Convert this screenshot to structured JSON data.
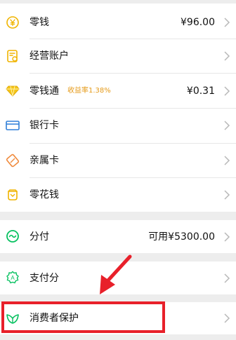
{
  "wallet_items": [
    {
      "label": "零钱",
      "value": "¥96.00",
      "icon": "coin-yen-icon"
    },
    {
      "label": "经营账户",
      "value": "",
      "icon": "business-account-icon"
    },
    {
      "label": "零钱通",
      "badge": "收益率1.38%",
      "value": "¥0.31",
      "icon": "diamond-icon"
    },
    {
      "label": "银行卡",
      "value": "",
      "icon": "bank-card-icon"
    },
    {
      "label": "亲属卡",
      "value": "",
      "icon": "family-card-icon"
    },
    {
      "label": "零花钱",
      "value": "",
      "icon": "pocket-money-icon"
    }
  ],
  "installment": {
    "label": "分付",
    "value": "可用¥5300.00",
    "icon": "installment-icon"
  },
  "payscore": {
    "label": "支付分",
    "icon": "payscore-icon"
  },
  "consumer_protection": {
    "label": "消费者保护",
    "icon": "consumer-protection-icon"
  },
  "colors": {
    "accent_green": "#07c160",
    "accent_gold": "#f0b400",
    "accent_blue": "#2f7fd8",
    "accent_orange": "#f08a3c",
    "badge_orange": "#e59a18",
    "annotation_red": "#e8202a"
  }
}
